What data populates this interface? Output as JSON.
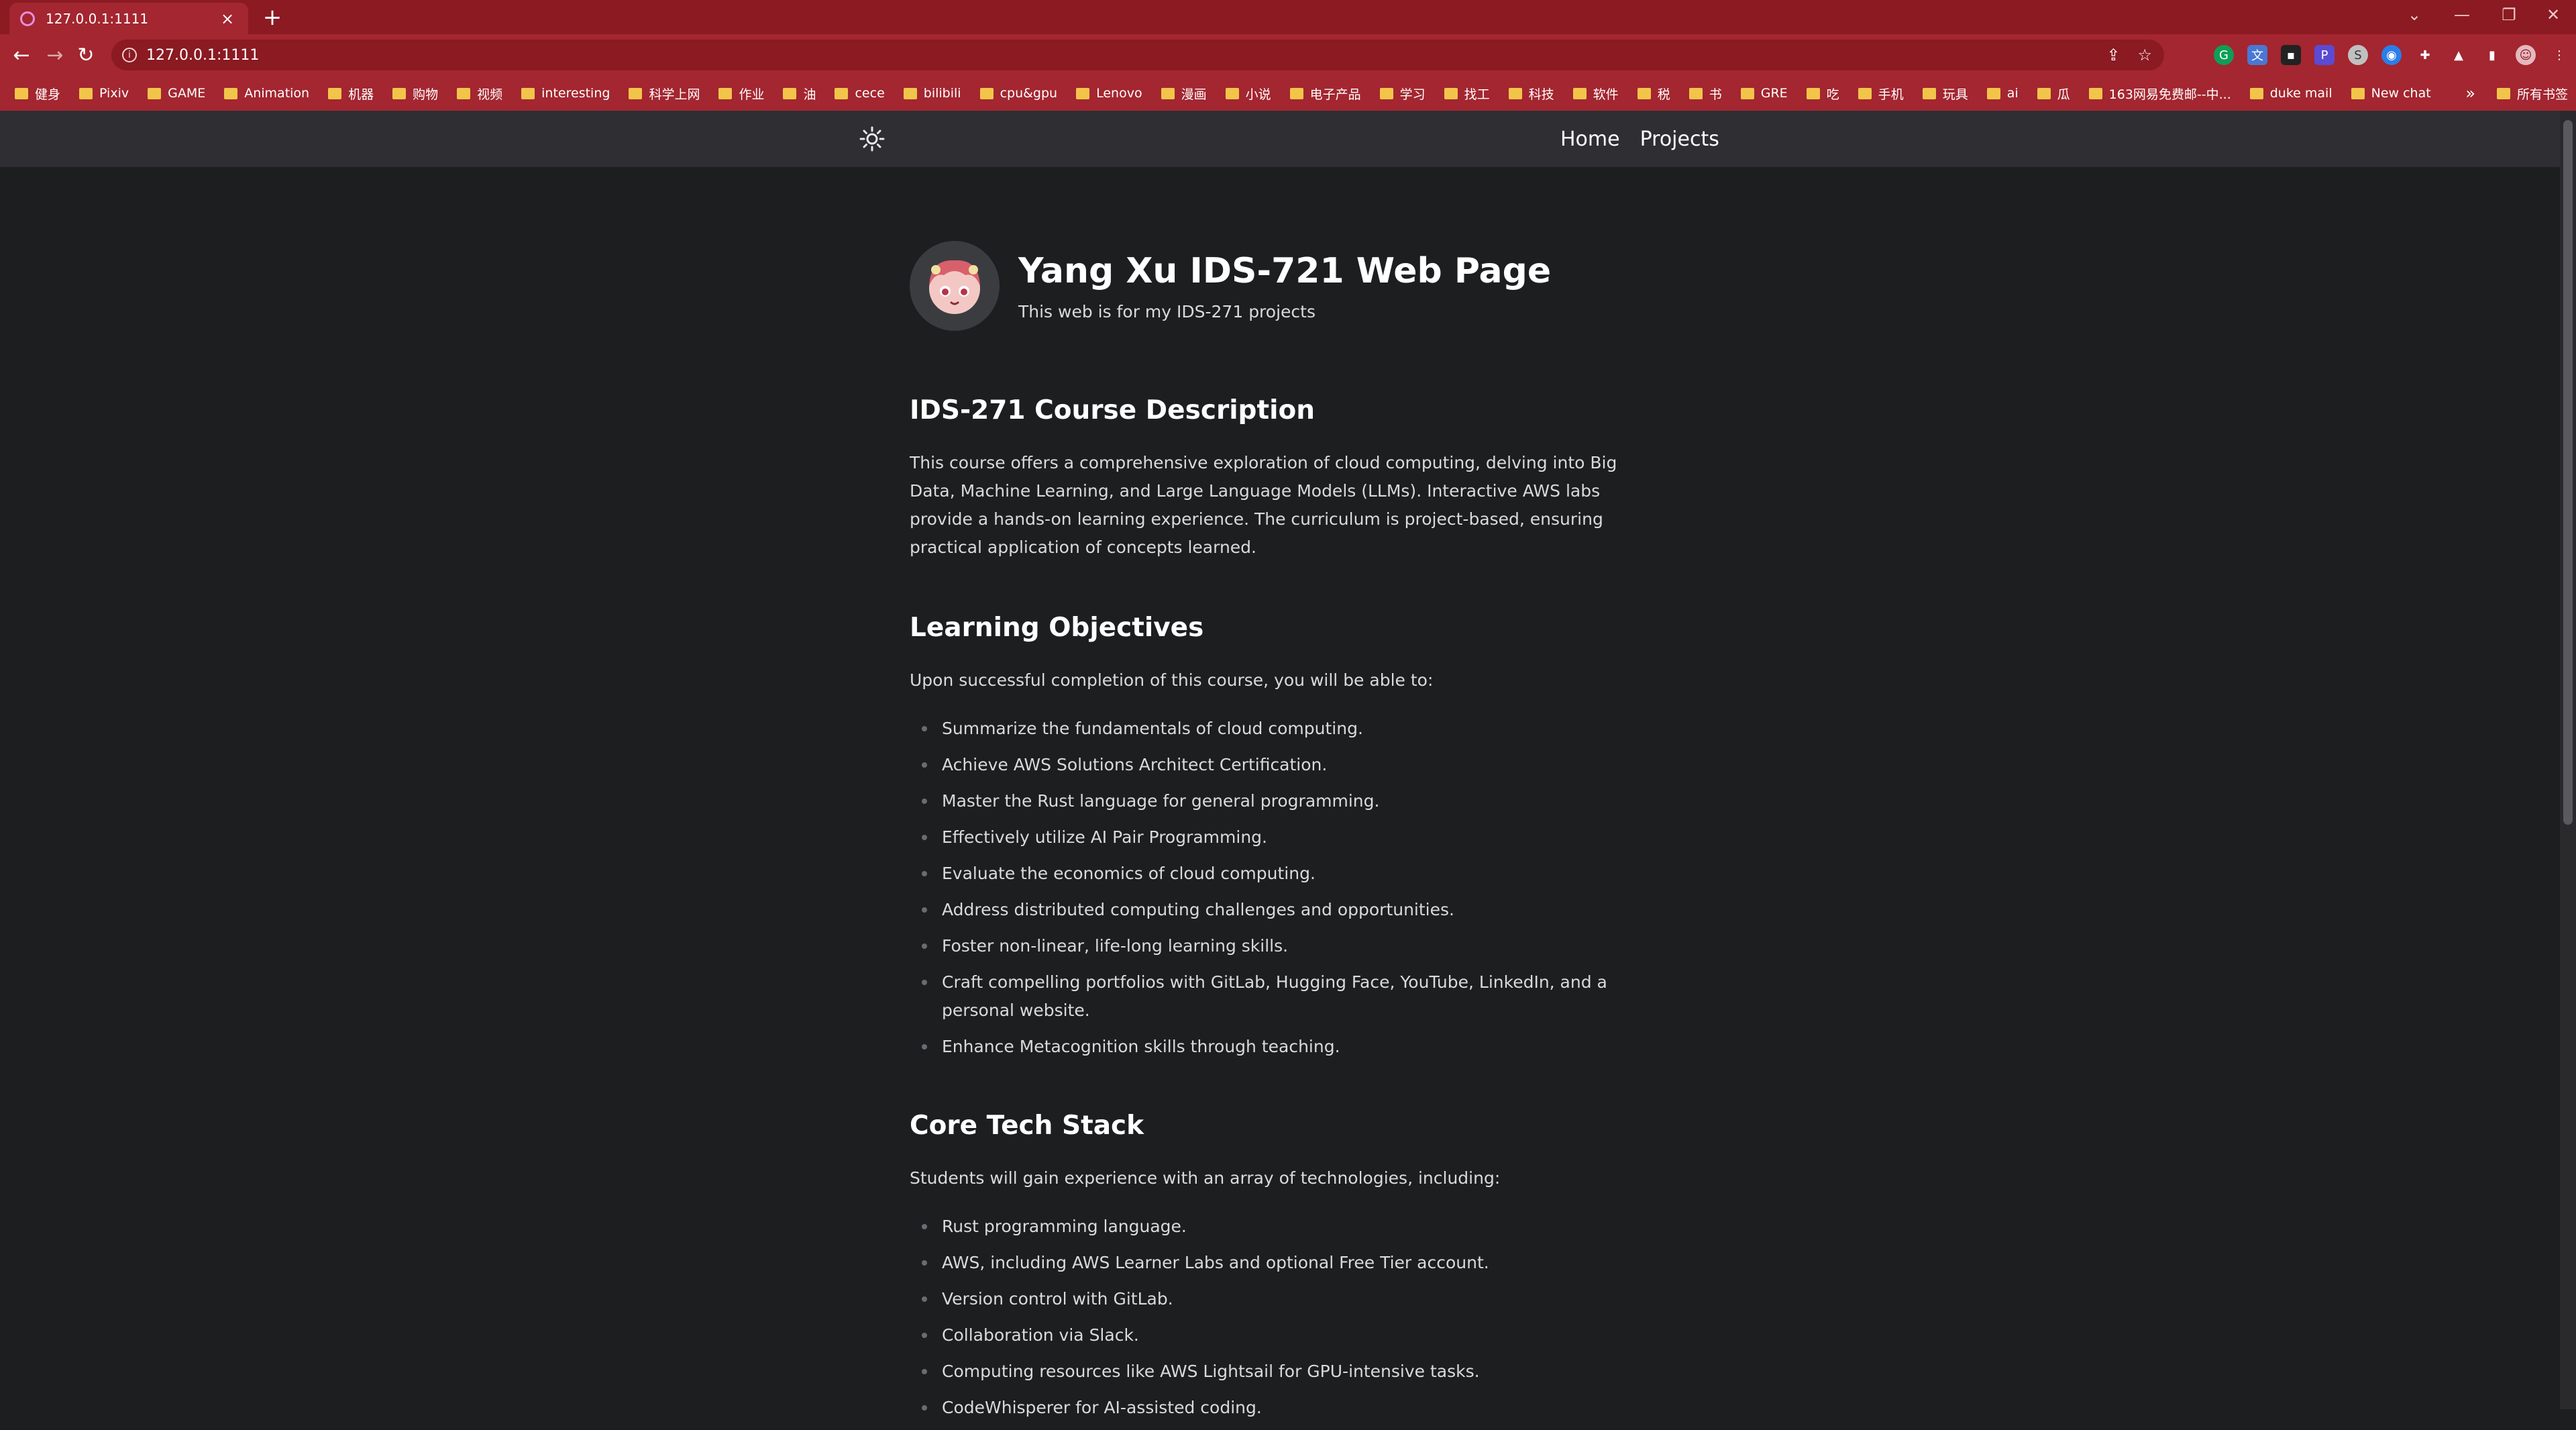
{
  "browser": {
    "tab": {
      "title": "127.0.0.1:1111",
      "close": "×"
    },
    "new_tab": "+",
    "window_controls": {
      "minimize": "—",
      "restore": "❐",
      "close": "✕",
      "tabsearch": "⌄"
    },
    "nav": {
      "back": "←",
      "forward": "→",
      "reload": "↻"
    },
    "address": {
      "url": "127.0.0.1:1111",
      "share": "⇪",
      "star": "☆"
    },
    "menu": "⋮",
    "bookmarks": [
      "健身",
      "Pixiv",
      "GAME",
      "Animation",
      "机器",
      "购物",
      "视频",
      "interesting",
      "科学上网",
      "作业",
      "油",
      "cece",
      "bilibili",
      "cpu&gpu",
      "Lenovo",
      "漫画",
      "小说",
      "电子产品",
      "学习",
      "找工",
      "科技",
      "软件",
      "税",
      "书",
      "GRE",
      "吃",
      "手机",
      "玩具",
      "ai",
      "瓜",
      "163网易免费邮--中...",
      "duke mail",
      "New chat"
    ],
    "bookmarks_more": "»",
    "all_bookmarks": "所有书签"
  },
  "site": {
    "nav": [
      "Home",
      "Projects"
    ],
    "title": "Yang Xu IDS-721 Web Page",
    "subtitle": "This web is for my IDS-271 projects",
    "sections": [
      {
        "heading": "IDS-271 Course Description",
        "text": "This course offers a comprehensive exploration of cloud computing, delving into Big Data, Machine Learning, and Large Language Models (LLMs). Interactive AWS labs provide a hands-on learning experience. The curriculum is project-based, ensuring practical application of concepts learned."
      },
      {
        "heading": "Learning Objectives",
        "text": "Upon successful completion of this course, you will be able to:",
        "items": [
          "Summarize the fundamentals of cloud computing.",
          "Achieve AWS Solutions Architect Certification.",
          "Master the Rust language for general programming.",
          "Effectively utilize AI Pair Programming.",
          "Evaluate the economics of cloud computing.",
          "Address distributed computing challenges and opportunities.",
          "Foster non-linear, life-long learning skills.",
          "Craft compelling portfolios with GitLab, Hugging Face, YouTube, LinkedIn, and a personal website.",
          "Enhance Metacognition skills through teaching."
        ]
      },
      {
        "heading": "Core Tech Stack",
        "text": "Students will gain experience with an array of technologies, including:",
        "items": [
          "Rust programming language.",
          "AWS, including AWS Learner Labs and optional Free Tier account.",
          "Version control with GitLab.",
          "Collaboration via Slack.",
          "Computing resources like AWS Lightsail for GPU-intensive tasks.",
          "CodeWhisperer for AI-assisted coding."
        ]
      }
    ]
  },
  "colors": {
    "tab_bar": "#8b1a22",
    "toolbar": "#a32630",
    "page_bg": "#1d1e20",
    "header_bg": "#2e2e33",
    "text": "#dadadb",
    "heading": "#ffffff"
  }
}
